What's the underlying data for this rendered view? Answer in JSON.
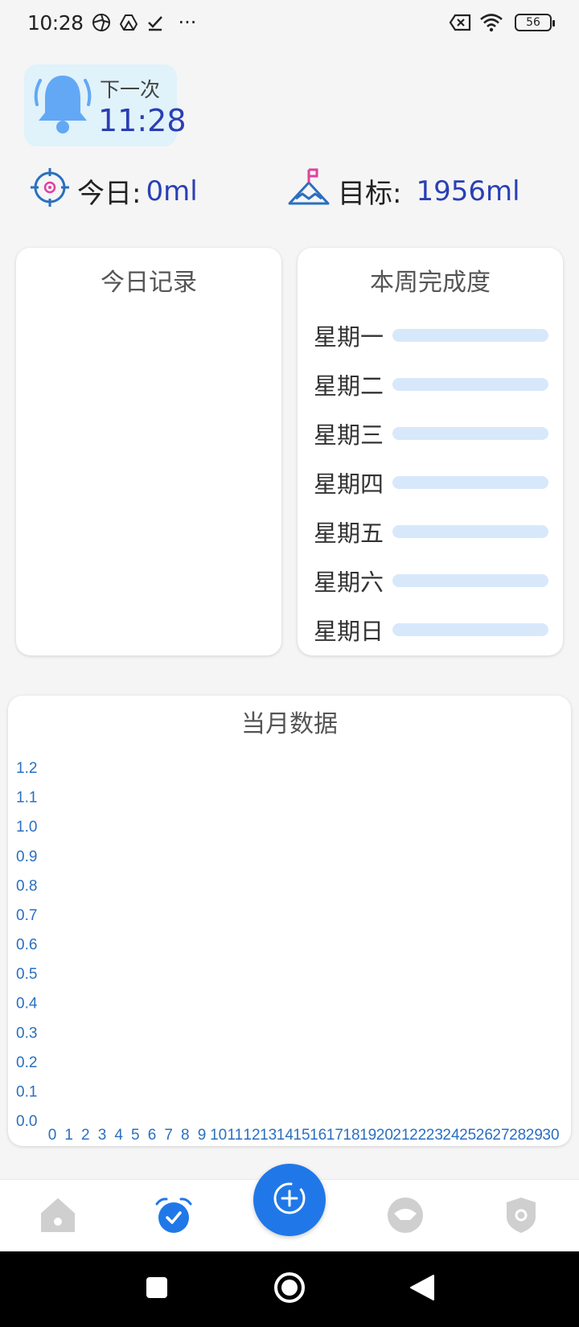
{
  "status_bar": {
    "time": "10:28",
    "battery": "56",
    "more": "···"
  },
  "next_reminder": {
    "label": "下一次",
    "time": "11:28"
  },
  "today": {
    "label": "今日:",
    "value": "0ml"
  },
  "goal": {
    "label": "目标:",
    "value": "1956ml"
  },
  "today_record": {
    "title": "今日记录"
  },
  "week_progress": {
    "title": "本周完成度",
    "days": [
      {
        "label": "星期一",
        "progress": 0
      },
      {
        "label": "星期二",
        "progress": 0
      },
      {
        "label": "星期三",
        "progress": 0
      },
      {
        "label": "星期四",
        "progress": 0
      },
      {
        "label": "星期五",
        "progress": 0
      },
      {
        "label": "星期六",
        "progress": 0
      },
      {
        "label": "星期日",
        "progress": 0
      }
    ],
    "track_color": "#d8e8fb",
    "fill_color": "#4a90e2"
  },
  "month_data": {
    "title": "当月数据"
  },
  "chart_data": {
    "type": "bar",
    "title": "当月数据",
    "categories": [
      "0",
      "1",
      "2",
      "3",
      "4",
      "5",
      "6",
      "7",
      "8",
      "9",
      "10",
      "11",
      "12",
      "13",
      "14",
      "15",
      "16",
      "17",
      "18",
      "19",
      "20",
      "21",
      "22",
      "23",
      "24",
      "25",
      "26",
      "27",
      "28",
      "29",
      "30"
    ],
    "values": [],
    "yticks": [
      "0.0",
      "0.1",
      "0.2",
      "0.3",
      "0.4",
      "0.5",
      "0.6",
      "0.7",
      "0.8",
      "0.9",
      "1.0",
      "1.1",
      "1.2"
    ],
    "ylim": [
      0,
      1.2
    ],
    "grid": false,
    "tick_color": "#2a6fc0"
  },
  "bottom_nav": {
    "items": [
      {
        "icon": "home-icon",
        "active": false
      },
      {
        "icon": "alarm-clock-icon",
        "active": true
      },
      {
        "icon": "add-record-icon",
        "active": false
      },
      {
        "icon": "eye-icon",
        "active": false
      },
      {
        "icon": "shield-icon",
        "active": false
      }
    ],
    "active_color": "#2078e8",
    "inactive_color": "#cfcfcf"
  },
  "colors": {
    "accent": "#2078e8",
    "value_text": "#2a3fb5",
    "next_card_bg": "#e0f2fa"
  }
}
